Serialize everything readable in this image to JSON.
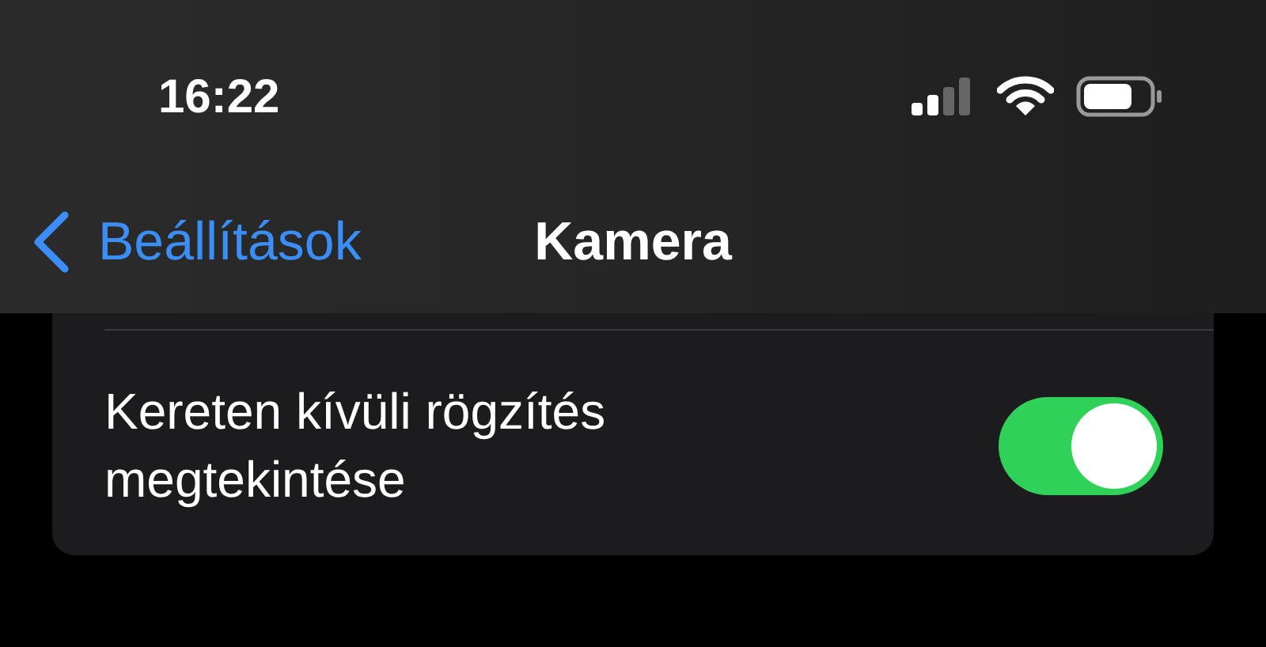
{
  "status_bar": {
    "time": "16:22"
  },
  "nav": {
    "back_label": "Beállítások",
    "title": "Kamera"
  },
  "settings": [
    {
      "label": "Kereten kívüli rögzítés megtekintése",
      "on": true
    }
  ]
}
